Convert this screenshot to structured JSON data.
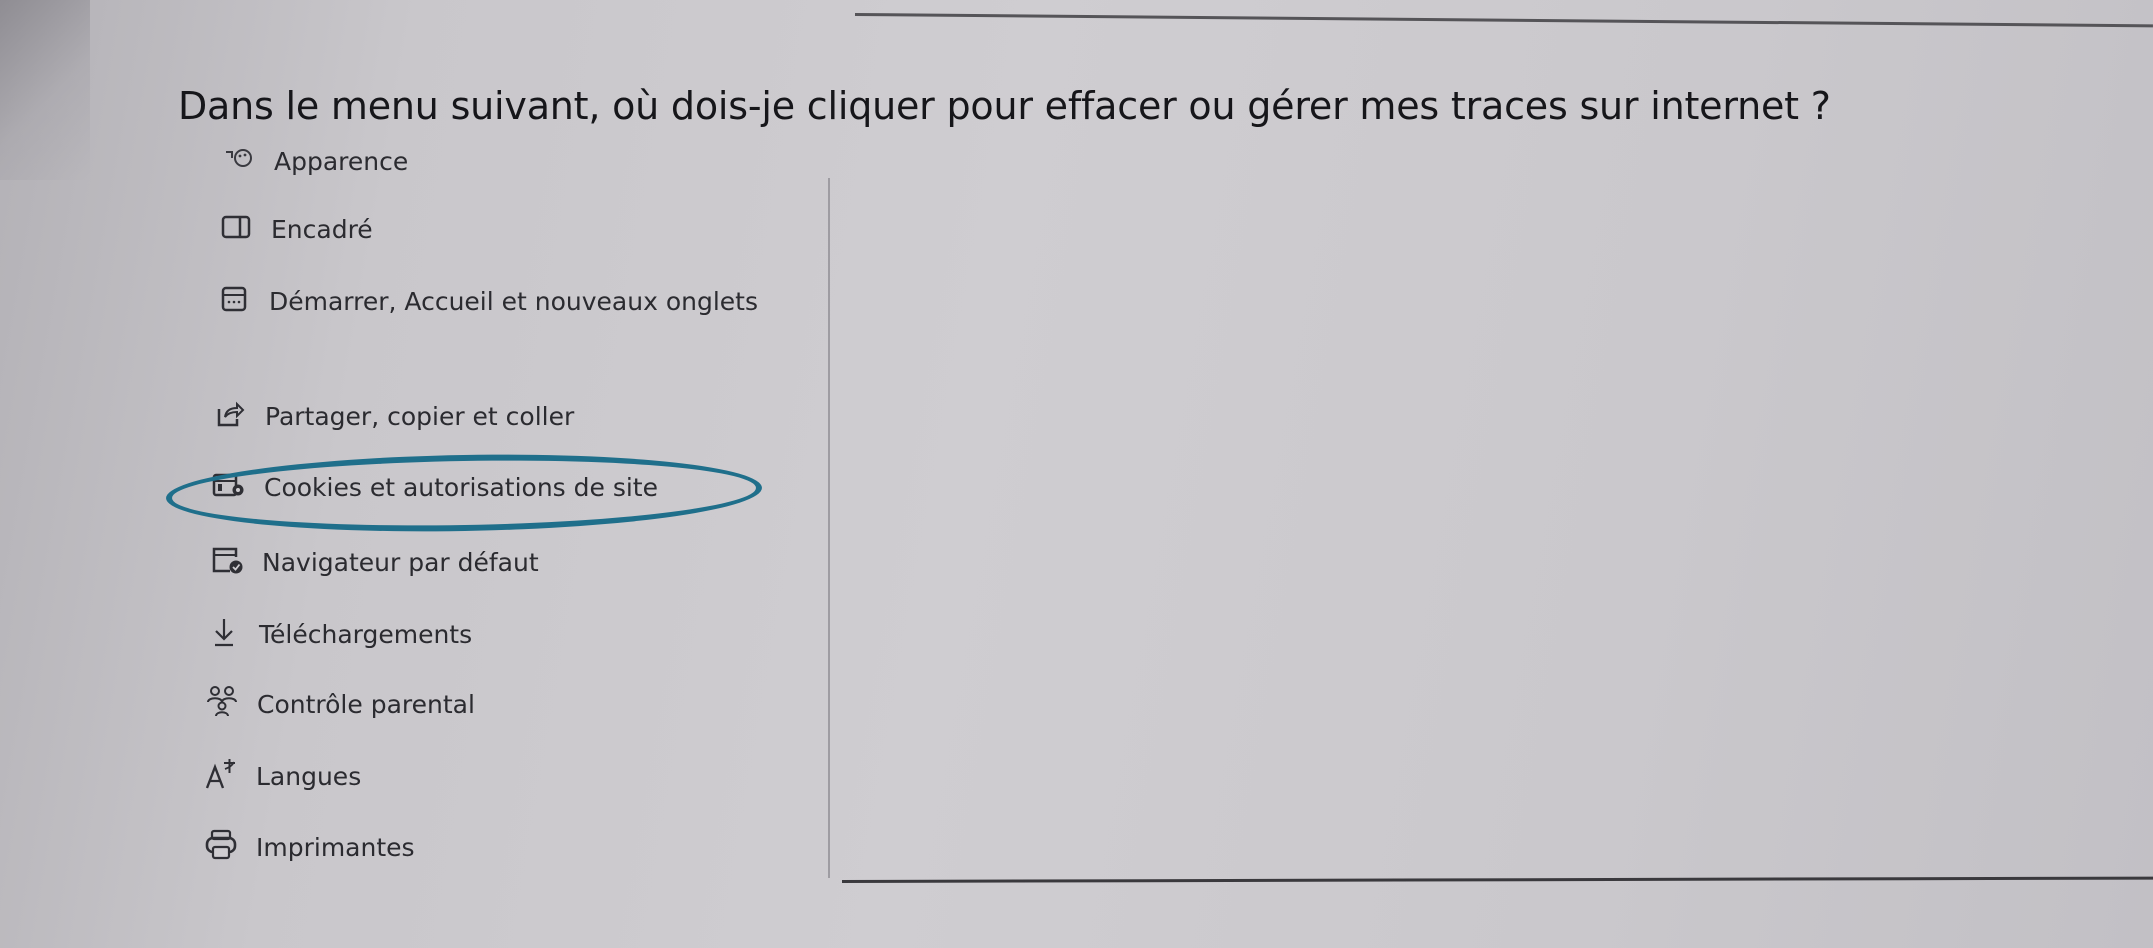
{
  "question": "Dans le menu suivant, où dois-je cliquer pour effacer ou gérer mes traces sur internet ?",
  "menu": {
    "items": [
      {
        "label": "Apparence",
        "icon": "appearance-icon"
      },
      {
        "label": "Encadré",
        "icon": "sidebar-icon"
      },
      {
        "label": "Démarrer, Accueil et nouveaux onglets",
        "icon": "start-home-icon"
      },
      {
        "label": "Partager, copier et coller",
        "icon": "share-icon"
      },
      {
        "label": "Cookies et autorisations de site",
        "icon": "cookies-permissions-icon",
        "highlighted": true
      },
      {
        "label": "Navigateur par défaut",
        "icon": "default-browser-icon"
      },
      {
        "label": "Téléchargements",
        "icon": "download-icon"
      },
      {
        "label": "Contrôle parental",
        "icon": "family-icon"
      },
      {
        "label": "Langues",
        "icon": "languages-icon"
      },
      {
        "label": "Imprimantes",
        "icon": "printer-icon"
      }
    ]
  },
  "colors": {
    "highlight_ring": "#1f6f8b",
    "paper": "#cfcdd1",
    "text": "#2b2b30"
  }
}
